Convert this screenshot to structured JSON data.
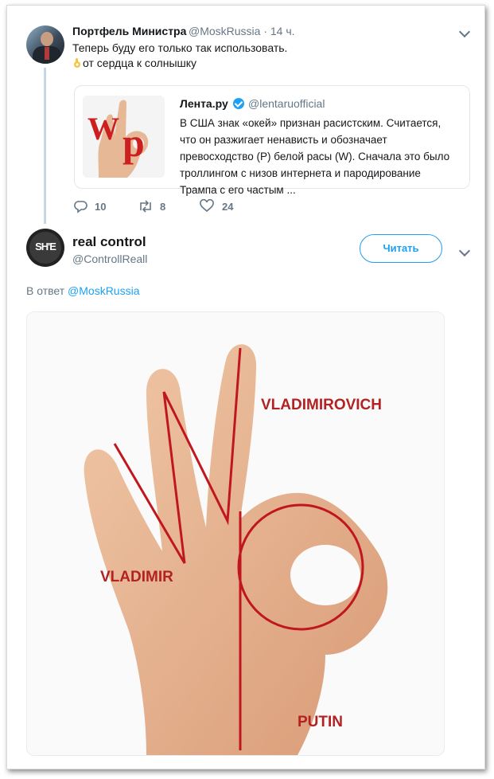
{
  "tweet1": {
    "author": "Портфель Министра",
    "handle": "@MoskRussia · 14 ч.",
    "line1": "Теперь буду его только так использовать.",
    "line2": "от сердца к солнышку",
    "emoji_icon": "ok-hand-icon",
    "actions": {
      "replies": "10",
      "retweets": "8",
      "likes": "24"
    }
  },
  "quote": {
    "author": "Лента.ру",
    "handle": "@lentaruofficial",
    "text": "В США знак «окей» признан расистским. Считается, что он разжигает ненависть и обозначает превосходство (P) белой расы (W). Сначала это было троллингом с низов интернета и пародирование Трампа с его частым ...",
    "thumb_letters": {
      "w": "W",
      "p": "p"
    }
  },
  "tweet2": {
    "author": "real control",
    "handle": "@ControllReall",
    "follow_label": "Читать",
    "avatar_text": "SH'E",
    "reply_prefix": "В ответ",
    "reply_handle": "@MoskRussia"
  },
  "image": {
    "label_vladimirovich": "VLADIMIROVICH",
    "label_vladimir": "VLADIMIR",
    "label_putin": "PUTIN"
  },
  "colors": {
    "accent": "#1da1f2",
    "line_red": "#c0171e",
    "label_red": "#b22222"
  }
}
